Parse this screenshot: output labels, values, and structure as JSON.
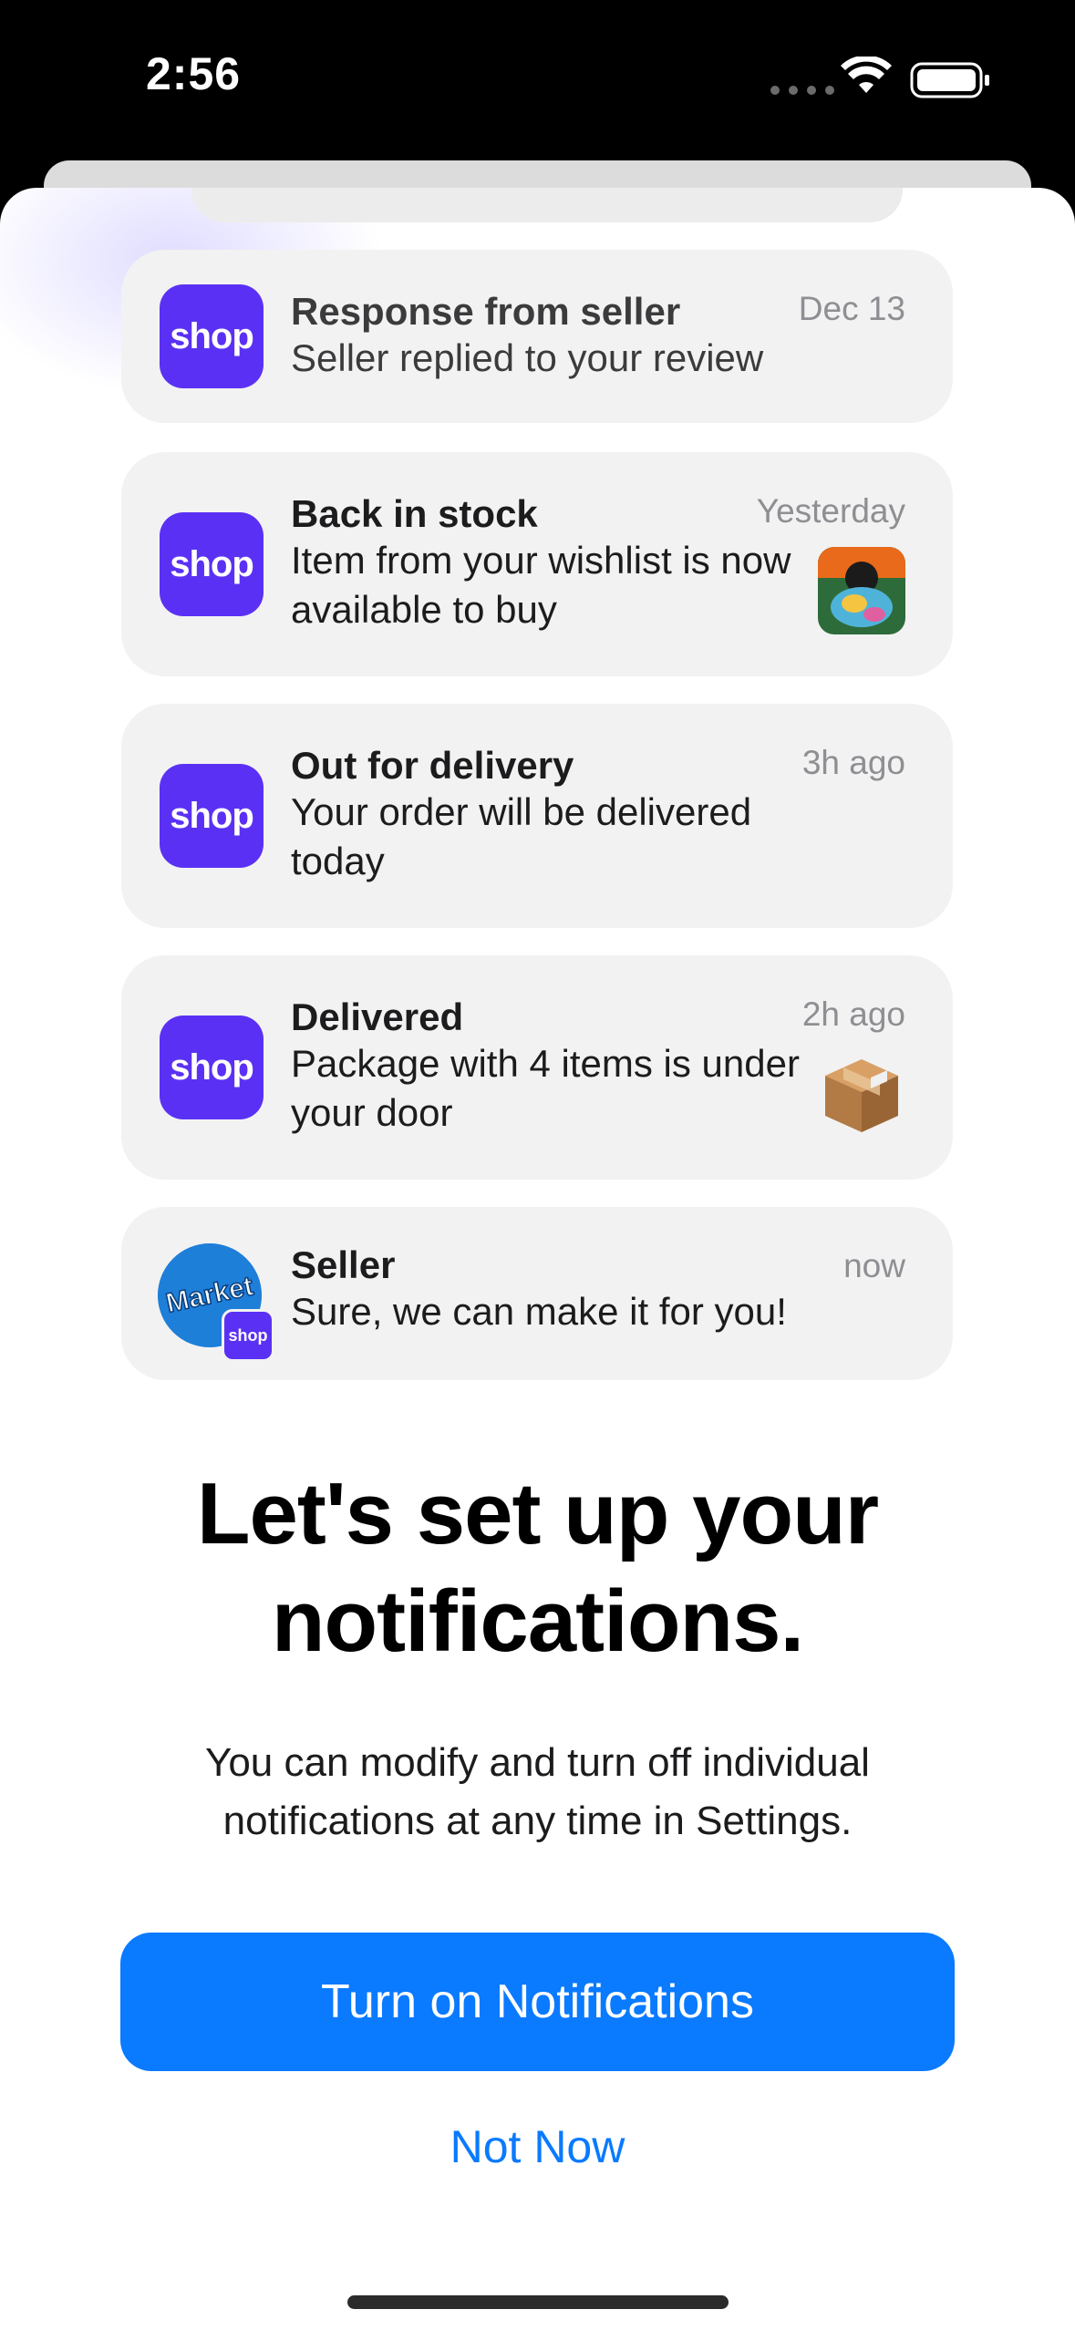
{
  "status_bar": {
    "time": "2:56"
  },
  "notifications": [
    {
      "app": "shop",
      "title": "Response from seller",
      "body": "Seller replied to your review",
      "time": "Dec 13"
    },
    {
      "app": "shop",
      "title": "Back in stock",
      "body": "Item from your wishlist is now available to buy",
      "time": "Yesterday",
      "thumbnail": "product-artwork"
    },
    {
      "app": "shop",
      "title": "Out for delivery",
      "body": "Your order will be delivered today",
      "time": "3h ago"
    },
    {
      "app": "shop",
      "title": "Delivered",
      "body": "Package with 4 items is under your door",
      "time": "2h ago",
      "thumbnail": "package-box"
    },
    {
      "app": "shop",
      "title": "Seller",
      "body": "Sure, we can make it for you!",
      "time": "now",
      "avatar_text": "Market",
      "badge": "shop"
    }
  ],
  "headline": "Let's set up your notifications.",
  "subtitle": "You can modify and turn off individual notifications at any time in Settings.",
  "buttons": {
    "primary": "Turn on Notifications",
    "secondary": "Not Now"
  },
  "colors": {
    "accent": "#0a7aff",
    "shop_purple": "#5a31f4",
    "card_bg": "#f2f2f2"
  }
}
